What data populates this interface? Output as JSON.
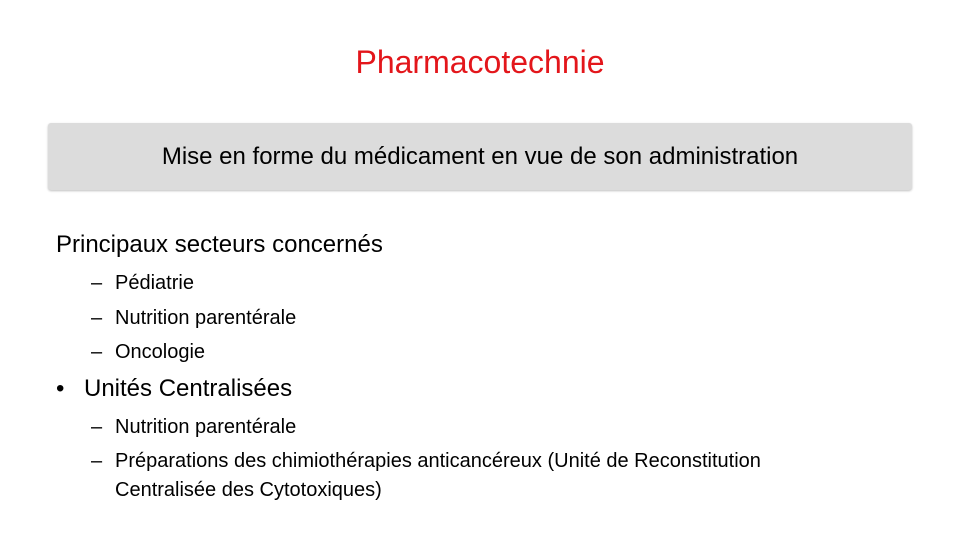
{
  "slide": {
    "title": "Pharmacotechnie",
    "subtitle": "Mise en forme du médicament en vue de son administration",
    "section1": {
      "heading": "Principaux secteurs concernés",
      "items": [
        "Pédiatrie",
        "Nutrition parentérale",
        "Oncologie"
      ]
    },
    "section2": {
      "bullet": "•",
      "heading": "Unités Centralisées",
      "items": [
        "Nutrition parentérale",
        "Préparations des chimiothérapies anticancéreux (Unité de Reconstitution",
        "Centralisée des Cytotoxiques)"
      ]
    },
    "dash": "–",
    "colors": {
      "title": "#e3161b",
      "subtitle_box": "#dcdcdc"
    }
  }
}
